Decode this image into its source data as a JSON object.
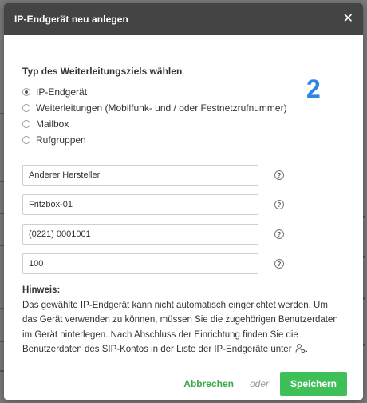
{
  "modal": {
    "title": "IP-Endgerät neu anlegen",
    "close_icon": "close-icon"
  },
  "target_type": {
    "title": "Typ des Weiterleitungsziels wählen",
    "options": [
      {
        "label": "IP-Endgerät",
        "checked": true
      },
      {
        "label": "Weiterleitungen (Mobilfunk- und / oder Festnetzrufnummer)",
        "checked": false
      },
      {
        "label": "Mailbox",
        "checked": false
      },
      {
        "label": "Rufgruppen",
        "checked": false
      }
    ]
  },
  "step_number": "2",
  "fields": {
    "manufacturer": "Anderer Hersteller",
    "device_name": "Fritzbox-01",
    "phone_number": "(0221) 0001001",
    "extension": "100",
    "help_icon": "question-icon"
  },
  "hint": {
    "title": "Hinweis:",
    "text": "Das gewählte IP-Endgerät kann nicht automatisch eingerichtet werden. Um das Gerät verwenden zu können, müssen Sie die zugehörigen Benutzerdaten im Gerät hinterlegen. Nach Abschluss der Einrichtung finden Sie die Benutzerdaten des SIP-Kontos in der Liste der IP-Endgeräte unter",
    "text_end": ".",
    "icon": "user-settings-icon"
  },
  "footer": {
    "cancel_label": "Abbrechen",
    "or_label": "oder",
    "save_label": "Speichern"
  },
  "colors": {
    "header_bg": "#444444",
    "accent_green": "#3fbf58",
    "step_blue": "#2f86e0"
  }
}
